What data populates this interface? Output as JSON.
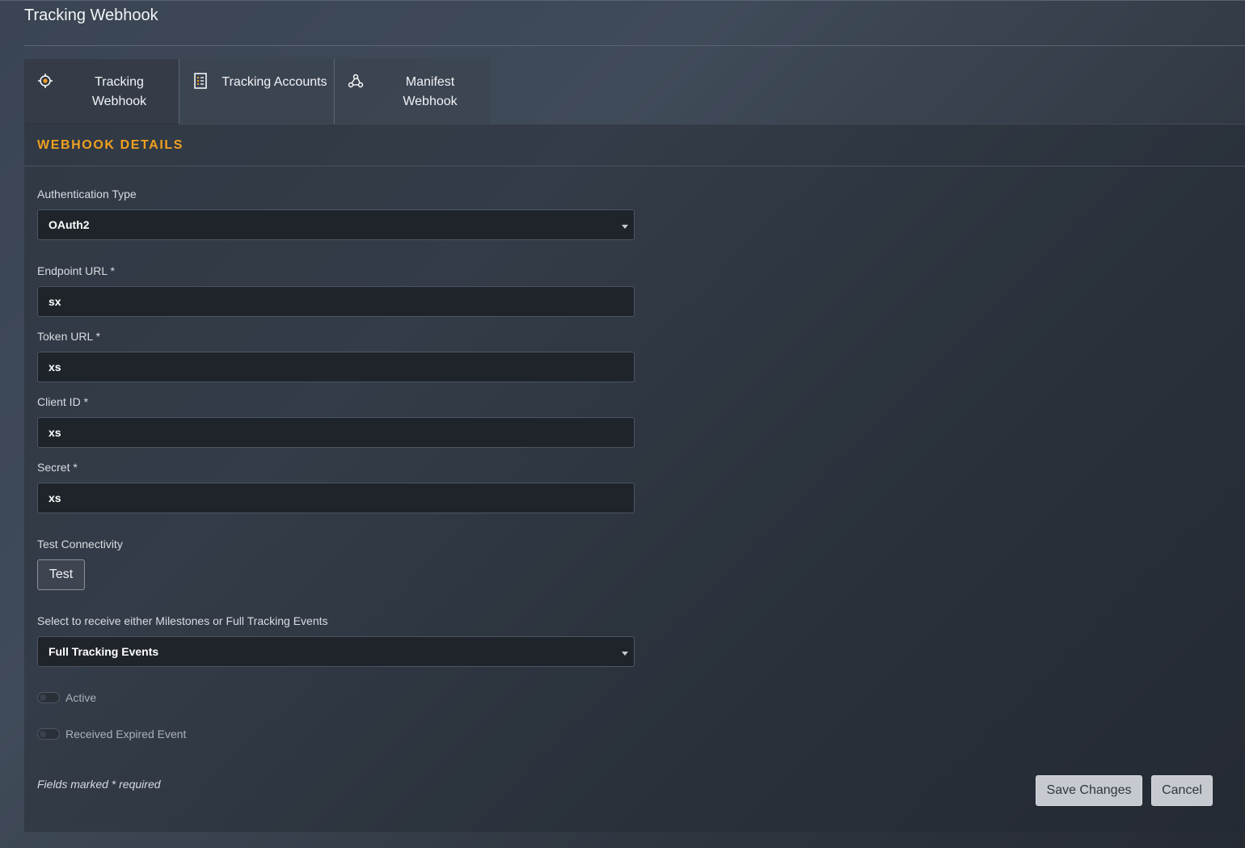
{
  "header": {
    "title": "Tracking Webhook"
  },
  "tabs": [
    {
      "label": "Tracking Webhook",
      "icon": "target-icon",
      "active": true
    },
    {
      "label": "Tracking Accounts",
      "icon": "list-icon",
      "active": false
    },
    {
      "label": "Manifest Webhook",
      "icon": "webhook-icon",
      "active": false
    }
  ],
  "section": {
    "title": "WEBHOOK DETAILS"
  },
  "form": {
    "auth_type": {
      "label": "Authentication Type",
      "value": "OAuth2"
    },
    "endpoint_url": {
      "label": "Endpoint URL *",
      "value": "sx"
    },
    "token_url": {
      "label": "Token URL *",
      "value": "xs"
    },
    "client_id": {
      "label": "Client ID *",
      "value": "xs"
    },
    "secret": {
      "label": "Secret *",
      "value": "xs"
    },
    "test": {
      "label": "Test Connectivity",
      "button": "Test"
    },
    "event_type": {
      "label": "Select to receive either Milestones or Full Tracking Events",
      "value": "Full Tracking Events"
    },
    "active": {
      "label": "Active",
      "checked": false
    },
    "expired": {
      "label": "Received Expired Event",
      "checked": false
    }
  },
  "footer": {
    "note": "Fields marked * required",
    "save_label": "Save Changes",
    "cancel_label": "Cancel"
  },
  "colors": {
    "accent": "#f0a020",
    "background": "#353c47"
  }
}
